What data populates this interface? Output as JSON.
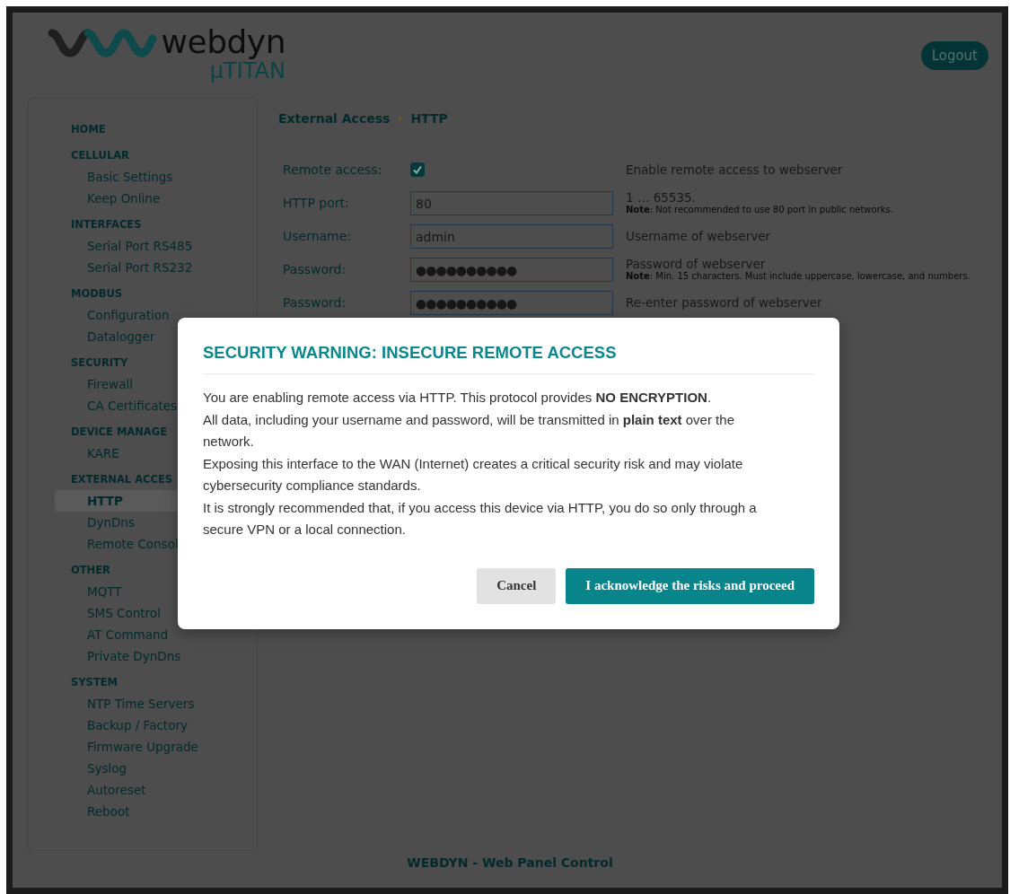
{
  "header": {
    "brand": "webdyn",
    "product": "µTITAN",
    "logout": "Logout"
  },
  "sidebar": {
    "sections": [
      {
        "title": "HOME"
      },
      {
        "title": "CELLULAR",
        "items": [
          {
            "label": "Basic Settings",
            "selected": false
          },
          {
            "label": "Keep Online",
            "selected": false
          }
        ]
      },
      {
        "title": "INTERFACES",
        "items": [
          {
            "label": "Serial Port RS485",
            "selected": false
          },
          {
            "label": "Serial Port RS232",
            "selected": false
          }
        ]
      },
      {
        "title": "MODBUS",
        "items": [
          {
            "label": "Configuration",
            "selected": false
          },
          {
            "label": "Datalogger",
            "selected": false
          }
        ]
      },
      {
        "title": "SECURITY",
        "items": [
          {
            "label": "Firewall",
            "selected": false
          },
          {
            "label": "CA Certificates",
            "selected": false
          }
        ]
      },
      {
        "title": "DEVICE MANAGE",
        "items": [
          {
            "label": "KARE",
            "selected": false
          }
        ]
      },
      {
        "title": "EXTERNAL ACCES",
        "items": [
          {
            "label": "HTTP",
            "selected": true
          },
          {
            "label": "DynDns",
            "selected": false
          },
          {
            "label": "Remote Consol",
            "selected": false
          }
        ]
      },
      {
        "title": "OTHER",
        "items": [
          {
            "label": "MQTT",
            "selected": false
          },
          {
            "label": "SMS Control",
            "selected": false
          },
          {
            "label": "AT Command",
            "selected": false
          },
          {
            "label": "Private DynDns",
            "selected": false
          }
        ]
      },
      {
        "title": "SYSTEM",
        "items": [
          {
            "label": "NTP Time Servers",
            "selected": false
          },
          {
            "label": "Backup / Factory",
            "selected": false
          },
          {
            "label": "Firmware Upgrade",
            "selected": false
          },
          {
            "label": "Syslog",
            "selected": false
          },
          {
            "label": "Autoreset",
            "selected": false
          },
          {
            "label": "Reboot",
            "selected": false
          }
        ]
      }
    ]
  },
  "breadcrumb": [
    "External Access",
    "HTTP"
  ],
  "form": {
    "rows": [
      {
        "kind": "checkbox",
        "label": "Remote access:",
        "checked": true,
        "description": "Enable remote access to webserver"
      },
      {
        "kind": "text",
        "label": "HTTP port:",
        "value": "80",
        "description": "1 … 65535.",
        "note": "**Note**: Not recommended to use 80 port in public networks."
      },
      {
        "kind": "text",
        "label": "Username:",
        "value": "admin",
        "description": "Username of webserver"
      },
      {
        "kind": "password",
        "label": "Password:",
        "value": "●●●●●●●●●●",
        "description": "Password of webserver",
        "note": "**Note**: Min. 15 characters. Must include uppercase, lowercase, and numbers."
      },
      {
        "kind": "password",
        "label": "Password:",
        "value": "●●●●●●●●●●",
        "description": "Re-enter password of webserver"
      }
    ]
  },
  "modal": {
    "title": "SECURITY WARNING: INSECURE REMOTE ACCESS",
    "paragraphs": [
      "You are enabling remote access via HTTP. This protocol provides **NO ENCRYPTION**.",
      "All data, including your username and password, will be transmitted in **plain text** over the network.",
      "Exposing this interface to the WAN (Internet) creates a critical security risk and may violate cybersecurity compliance standards.",
      "It is strongly recommended that, if you access this device via HTTP, you do so only through a secure VPN or a local connection."
    ],
    "buttons": [
      {
        "kind": "secondary",
        "label": "Cancel"
      },
      {
        "kind": "primary",
        "label": "I acknowledge the risks and proceed"
      }
    ]
  },
  "footer": "WEBDYN - Web Panel Control"
}
